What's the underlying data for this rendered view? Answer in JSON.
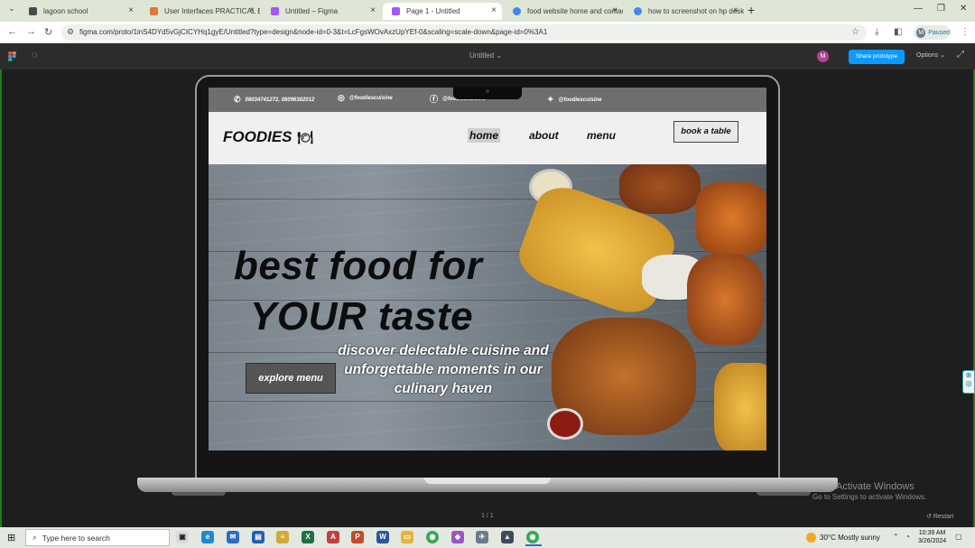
{
  "browser": {
    "tabs": [
      {
        "label": "lagoon school",
        "color": "#4a4a4a"
      },
      {
        "label": "User Interfaces PRACTICAL EXA...",
        "color": "#e0783c"
      },
      {
        "label": "Untitled – Figma",
        "color": "#a259ff"
      },
      {
        "label": "Page 1 - Untitled",
        "color": "#a259ff"
      },
      {
        "label": "food website home and contac...",
        "color": "#4285f4"
      },
      {
        "label": "how to screenshot on hp deskto...",
        "color": "#4285f4"
      }
    ],
    "url": "figma.com/proto/1inS4DYd5vGjCICYHq1gyE/Untitled?type=design&node-id=0-3&t=LcFgsWOvAxzUpYEf-0&scaling=scale-down&page-id=0%3A1",
    "profile_initial": "M",
    "profile_status": "Paused"
  },
  "figma": {
    "file_title": "Untitled",
    "avatar_initial": "M",
    "share_label": "Share prototype",
    "options_label": "Options",
    "pager": "1 / 1",
    "restart_label": "Restart"
  },
  "site": {
    "phone": "08034741272, 08096382012",
    "instagram": "@foodiescuisine",
    "facebook": "@foodiescuisine",
    "twitter": "@foodiescuisine",
    "brand": "FOODIES",
    "nav": {
      "home": "home",
      "about": "about",
      "menu": "menu"
    },
    "book_label": "book a table",
    "hero_line1": "best food for",
    "hero_line2": "YOUR taste",
    "hero_sub": "discover delectable cuisine and unforgettable moments in our culinary haven",
    "explore_label": "explore menu"
  },
  "windows": {
    "activate_title": "Activate Windows",
    "activate_sub": "Go to Settings to activate Windows.",
    "search_placeholder": "Type here to search",
    "weather": "30°C  Mostly sunny",
    "time": "10:39 AM",
    "date": "3/26/2024"
  }
}
